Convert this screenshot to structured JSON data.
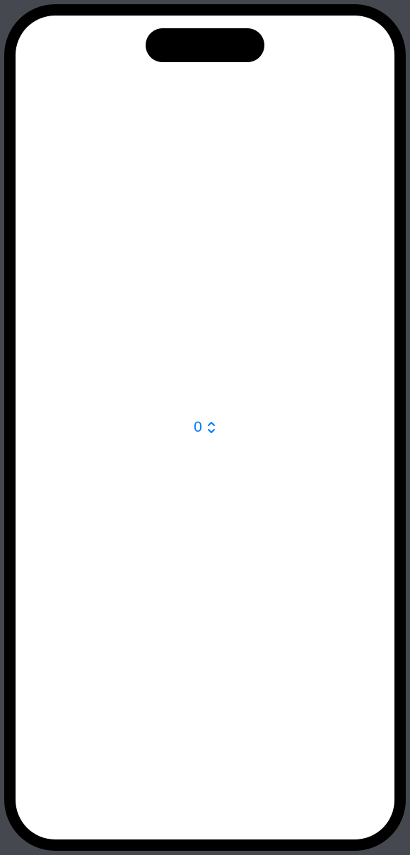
{
  "picker": {
    "value": "0",
    "accent_color": "#007aff"
  }
}
